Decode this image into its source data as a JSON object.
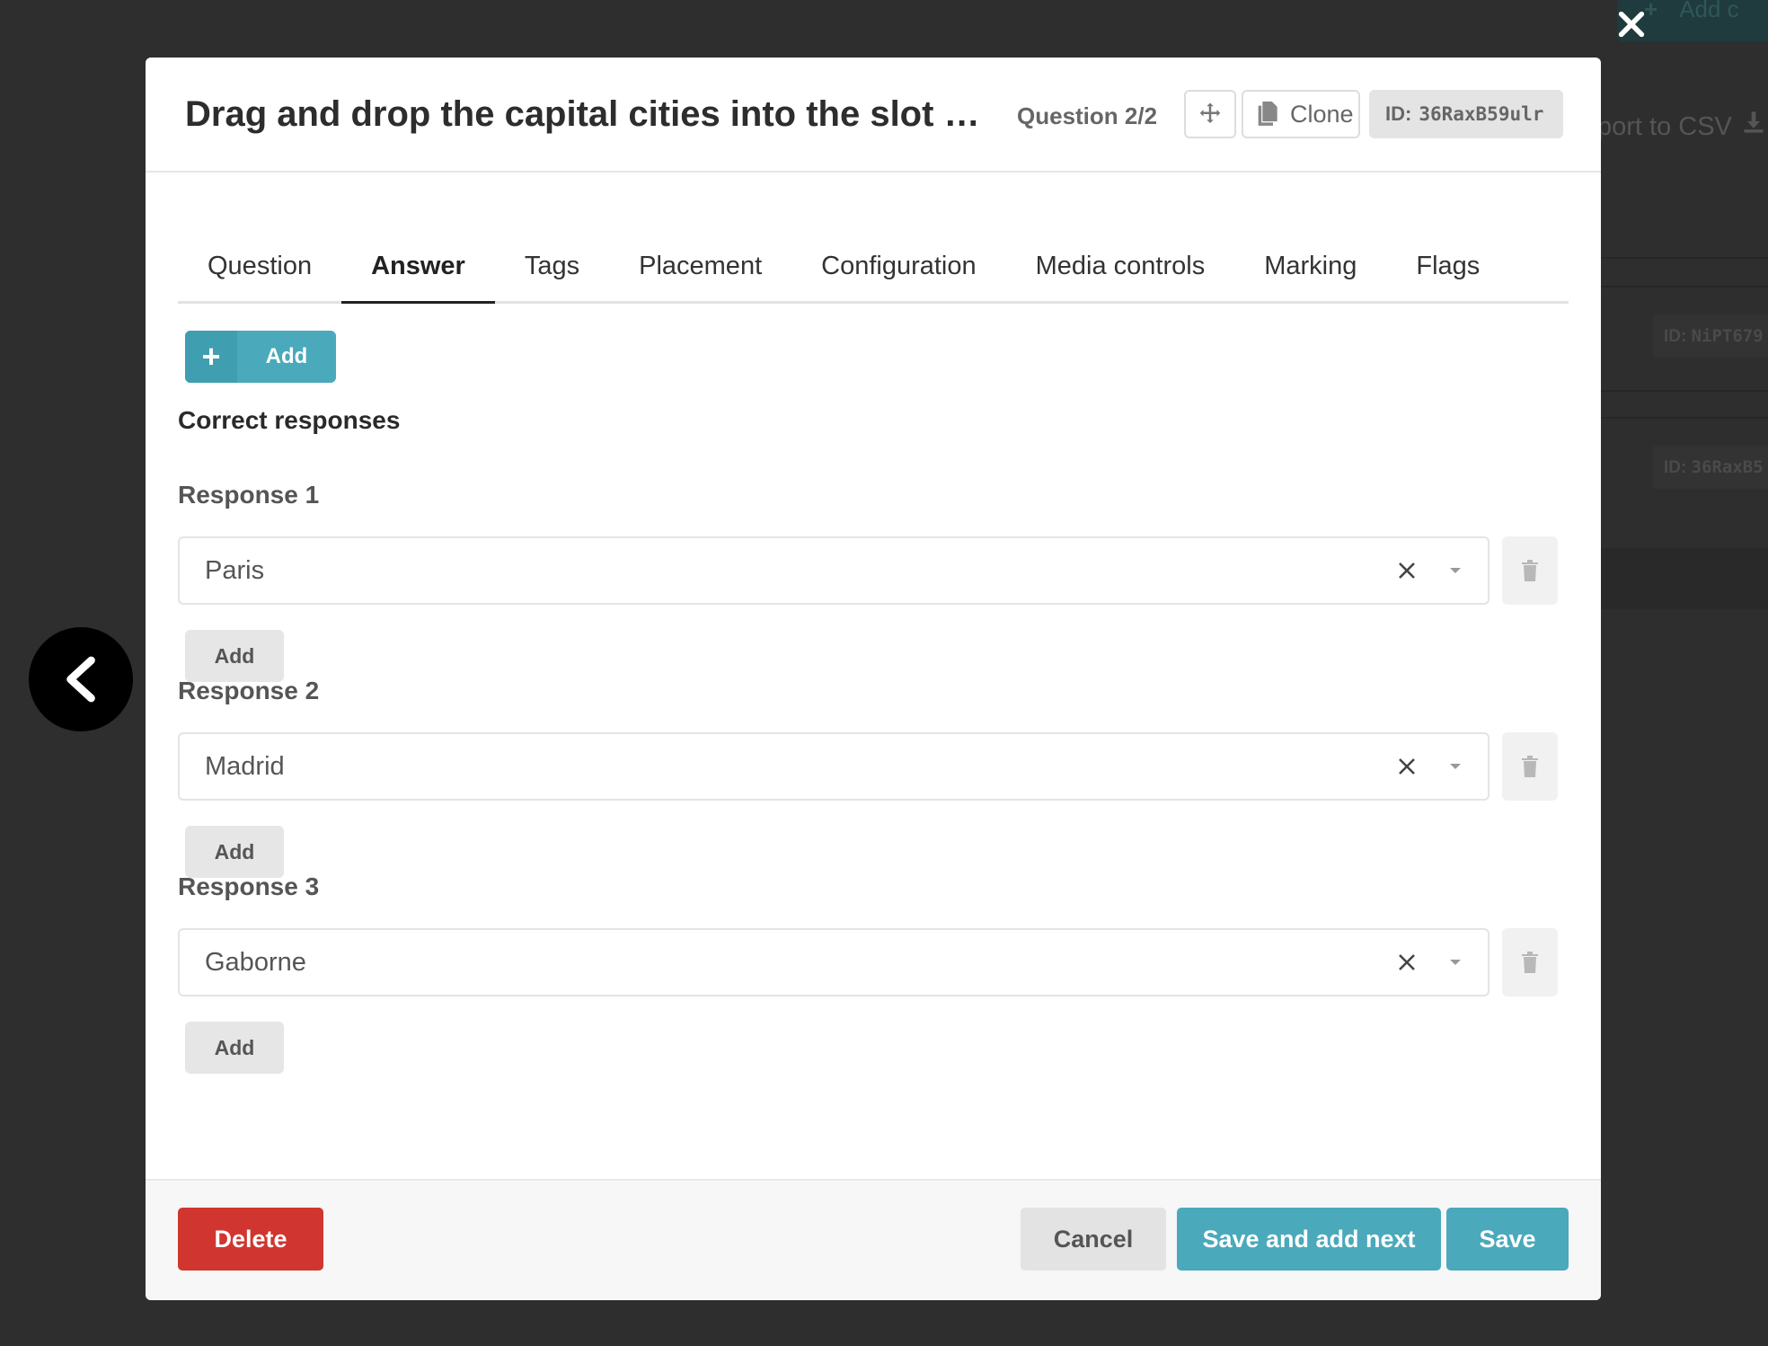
{
  "background": {
    "add_button_label": "Add c",
    "export_label": "port to CSV",
    "row_ids": [
      {
        "prefix": "ID:",
        "code": "NiPT679"
      },
      {
        "prefix": "ID:",
        "code": "36RaxB5"
      }
    ]
  },
  "modal": {
    "title": "Drag and drop the capital cities into the slot for…",
    "question_count": "Question 2/2",
    "clone_label": "Clone",
    "id_prefix": "ID:",
    "id_code": "36RaxB59ulr",
    "tabs": [
      {
        "label": "Question",
        "active": false
      },
      {
        "label": "Answer",
        "active": true
      },
      {
        "label": "Tags",
        "active": false
      },
      {
        "label": "Placement",
        "active": false
      },
      {
        "label": "Configuration",
        "active": false
      },
      {
        "label": "Media controls",
        "active": false
      },
      {
        "label": "Marking",
        "active": false
      },
      {
        "label": "Flags",
        "active": false
      }
    ],
    "add_button_label": "Add",
    "section_title": "Correct responses",
    "responses": [
      {
        "label": "Response 1",
        "value": "Paris",
        "add_label": "Add"
      },
      {
        "label": "Response 2",
        "value": "Madrid",
        "add_label": "Add"
      },
      {
        "label": "Response 3",
        "value": "Gaborne",
        "add_label": "Add"
      }
    ],
    "footer": {
      "delete_label": "Delete",
      "cancel_label": "Cancel",
      "save_next_label": "Save and add next",
      "save_label": "Save"
    }
  },
  "colors": {
    "accent": "#4aa9bb",
    "danger": "#d0362f",
    "overlay": "#2b2b2b"
  }
}
